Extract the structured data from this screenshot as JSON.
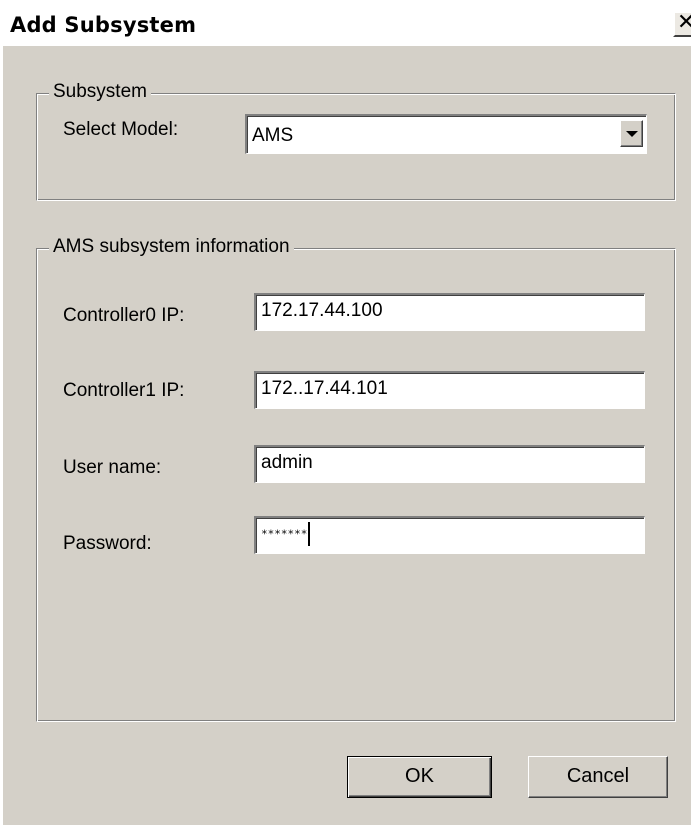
{
  "window": {
    "title": "Add Subsystem",
    "close_glyph": "✕"
  },
  "subsystem_group": {
    "label": "Subsystem",
    "select_model_label": "Select Model:",
    "select_model_value": "AMS",
    "options": [
      "AMS"
    ]
  },
  "info_group": {
    "label": "AMS subsystem information",
    "controller0_label": "Controller0 IP:",
    "controller0_value": "172.17.44.100",
    "controller1_label": "Controller1 IP:",
    "controller1_value": "172..17.44.101",
    "username_label": "User name:",
    "username_value": "admin",
    "password_label": "Password:",
    "password_value": "*******"
  },
  "buttons": {
    "ok": "OK",
    "cancel": "Cancel"
  },
  "icons": {
    "close": "close-icon",
    "dropdown": "chevron-down-icon"
  },
  "colors": {
    "dialog_background": "#d4d0c8",
    "title_bar": "#ffffff",
    "field_background": "#ffffff"
  }
}
